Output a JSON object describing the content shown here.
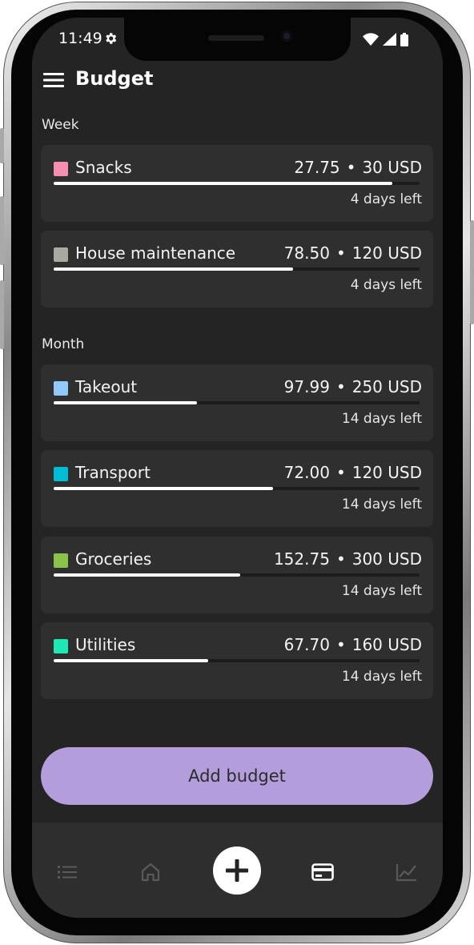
{
  "status_bar": {
    "time": "11:49",
    "icons": [
      "gear-icon",
      "wifi-icon",
      "signal-icon",
      "battery-icon"
    ]
  },
  "app_bar": {
    "title": "Budget",
    "menu_icon": "menu-icon"
  },
  "sections": [
    {
      "label": "Week",
      "budgets": [
        {
          "name": "Snacks",
          "spent": "27.75",
          "limit": "30 USD",
          "separator": "•",
          "days_left": "4 days left",
          "color": "#f48fb1",
          "progress": 0.925
        },
        {
          "name": "House maintenance",
          "spent": "78.50",
          "limit": "120 USD",
          "separator": "•",
          "days_left": "4 days left",
          "color": "#a5aba3",
          "progress": 0.654
        }
      ]
    },
    {
      "label": "Month",
      "budgets": [
        {
          "name": "Takeout",
          "spent": "97.99",
          "limit": "250 USD",
          "separator": "•",
          "days_left": "14 days left",
          "color": "#90caf9",
          "progress": 0.392
        },
        {
          "name": "Transport",
          "spent": "72.00",
          "limit": "120 USD",
          "separator": "•",
          "days_left": "14 days left",
          "color": "#00bcd4",
          "progress": 0.6
        },
        {
          "name": "Groceries",
          "spent": "152.75",
          "limit": "300 USD",
          "separator": "•",
          "days_left": "14 days left",
          "color": "#8bc34a",
          "progress": 0.509
        },
        {
          "name": "Utilities",
          "spent": "67.70",
          "limit": "160 USD",
          "separator": "•",
          "days_left": "14 days left",
          "color": "#1de9b6",
          "progress": 0.423
        }
      ]
    }
  ],
  "add_button_label": "Add budget",
  "accent_color": "#b39ddb",
  "bottom_nav": {
    "items": [
      "list-icon",
      "home-icon",
      "add-icon",
      "card-icon",
      "chart-icon"
    ],
    "active": "card-icon"
  }
}
